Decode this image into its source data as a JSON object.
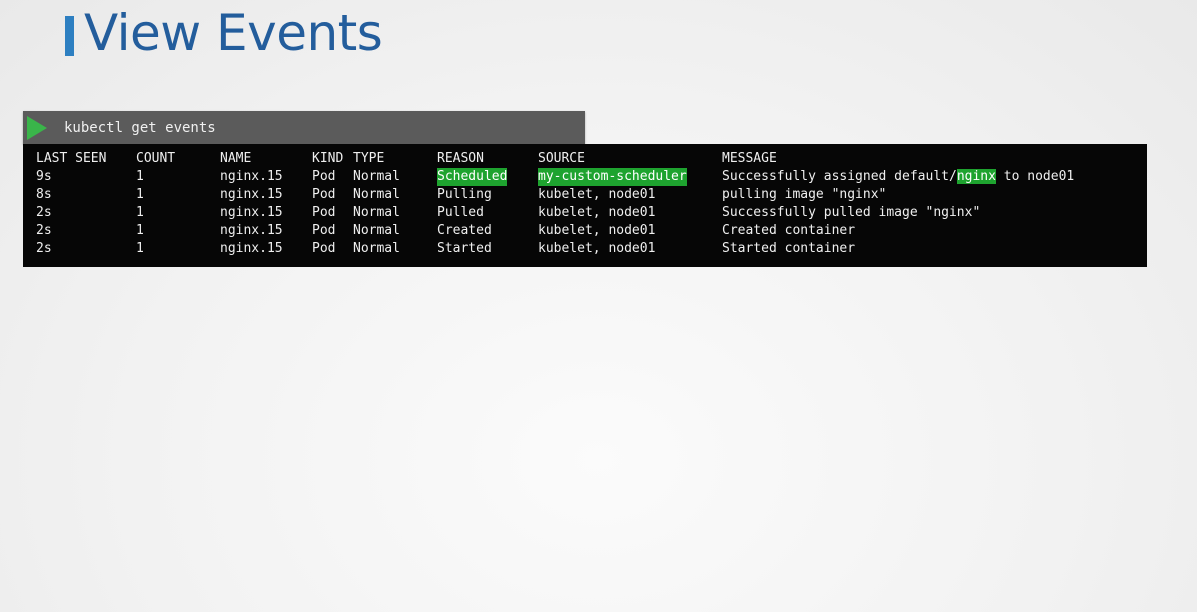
{
  "slide": {
    "title": "View Events"
  },
  "command": {
    "text": "kubectl get events"
  },
  "table": {
    "headers": {
      "last_seen": "LAST SEEN",
      "count": "COUNT",
      "name": "NAME",
      "kind": "KIND",
      "type": "TYPE",
      "reason": "REASON",
      "source": "SOURCE",
      "message": "MESSAGE"
    },
    "rows": [
      {
        "last_seen": "9s",
        "count": "1",
        "name": "nginx.15",
        "kind": "Pod",
        "type": "Normal",
        "reason": "Scheduled",
        "source": "my-custom-scheduler",
        "message_prefix": "Successfully assigned default/",
        "message_highlight": "nginx",
        "message_suffix": " to node01"
      },
      {
        "last_seen": "8s",
        "count": "1",
        "name": "nginx.15",
        "kind": "Pod",
        "type": "Normal",
        "reason": "Pulling",
        "source": "kubelet, node01",
        "message": "pulling image \"nginx\""
      },
      {
        "last_seen": "2s",
        "count": "1",
        "name": "nginx.15",
        "kind": "Pod",
        "type": "Normal",
        "reason": "Pulled",
        "source": "kubelet, node01",
        "message": "Successfully pulled image \"nginx\""
      },
      {
        "last_seen": "2s",
        "count": "1",
        "name": "nginx.15",
        "kind": "Pod",
        "type": "Normal",
        "reason": "Created",
        "source": "kubelet, node01",
        "message": "Created container"
      },
      {
        "last_seen": "2s",
        "count": "1",
        "name": "nginx.15",
        "kind": "Pod",
        "type": "Normal",
        "reason": "Started",
        "source": "kubelet, node01",
        "message": "Started container"
      }
    ]
  },
  "colors": {
    "title": "#235d9c",
    "accent_bar": "#2d7fc1",
    "highlight": "#1ea32f",
    "terminal_bg": "#060606",
    "command_bar_bg": "#5b5b5b",
    "play_icon": "#3ab54a"
  },
  "icons": {
    "run": "play-icon"
  }
}
